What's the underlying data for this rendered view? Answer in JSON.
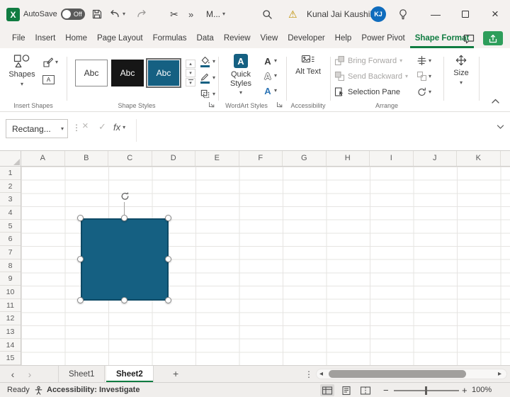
{
  "colors": {
    "excel_green": "#107C41",
    "share_green": "#2E9E5B",
    "shape_fill": "#156082",
    "shape_outline": "#0E4A66",
    "avatar_blue": "#0F6CBD"
  },
  "titlebar": {
    "autosave_label": "AutoSave",
    "autosave_state": "Off",
    "doc_menu_label": "M...",
    "user_name": "Kunal Jai Kaushik",
    "user_initials": "KJ"
  },
  "ribbon_tabs": [
    {
      "label": "File"
    },
    {
      "label": "Insert"
    },
    {
      "label": "Home"
    },
    {
      "label": "Page Layout"
    },
    {
      "label": "Formulas"
    },
    {
      "label": "Data"
    },
    {
      "label": "Review"
    },
    {
      "label": "View"
    },
    {
      "label": "Developer"
    },
    {
      "label": "Help"
    },
    {
      "label": "Power Pivot"
    },
    {
      "label": "Shape Format"
    }
  ],
  "ribbon": {
    "insert_shapes": {
      "group_label": "Insert Shapes",
      "shapes_label": "Shapes"
    },
    "shape_styles": {
      "group_label": "Shape Styles",
      "thumbnails": [
        {
          "label": "Abc"
        },
        {
          "label": "Abc"
        },
        {
          "label": "Abc"
        }
      ]
    },
    "wordart": {
      "group_label": "WordArt Styles",
      "quick_styles_label": "Quick Styles"
    },
    "accessibility": {
      "group_label": "Accessibility",
      "alt_text_label": "Alt Text"
    },
    "arrange": {
      "group_label": "Arrange",
      "bring_forward_label": "Bring Forward",
      "send_backward_label": "Send Backward",
      "selection_pane_label": "Selection Pane"
    },
    "size": {
      "button_label": "Size"
    }
  },
  "formula_bar": {
    "name_box_value": "Rectang...",
    "fx_label": "fx"
  },
  "grid": {
    "column_headers": [
      "A",
      "B",
      "C",
      "D",
      "E",
      "F",
      "G",
      "H",
      "I",
      "J",
      "K"
    ],
    "row_headers": [
      "1",
      "2",
      "3",
      "4",
      "5",
      "6",
      "7",
      "8",
      "9",
      "10",
      "11",
      "12",
      "13",
      "14",
      "15"
    ]
  },
  "sheet_bar": {
    "tabs": [
      {
        "label": "Sheet1"
      },
      {
        "label": "Sheet2"
      }
    ],
    "active_tab": "Sheet2"
  },
  "status_bar": {
    "ready_label": "Ready",
    "accessibility_label": "Accessibility: Investigate",
    "zoom_value": "100%"
  },
  "icons": {
    "caret_down": "▾",
    "caret_up": "▴",
    "scissors": "✂",
    "warning": "⚠",
    "overflow": "»",
    "vertical_dots": "⋮",
    "minimize": "—",
    "close": "×",
    "cancel": "×",
    "check": "✓",
    "nav_left": "‹",
    "nav_right": "›",
    "scroll_left": "◂",
    "scroll_right": "▸",
    "add_sheet": "+",
    "zoom_out": "−",
    "zoom_in": "+",
    "letter_a": "A"
  }
}
